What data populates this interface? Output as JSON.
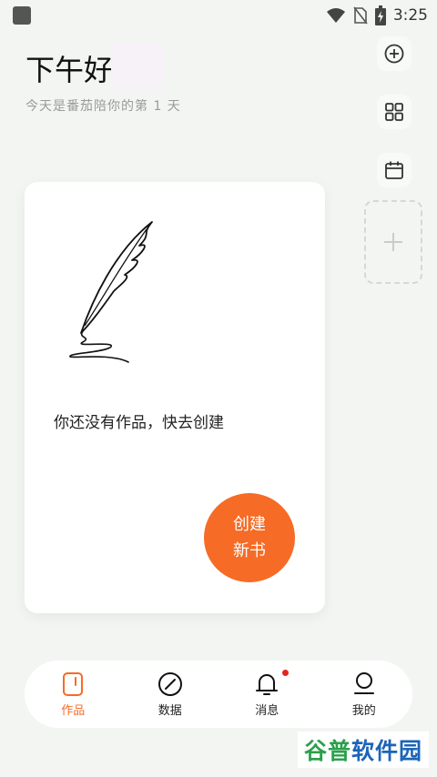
{
  "status_bar": {
    "time": "3:25"
  },
  "header": {
    "greeting": "下午好",
    "subtitle": "今天是番茄陪你的第 1 天"
  },
  "side_actions": [
    {
      "icon": "plus-circle-icon"
    },
    {
      "icon": "grid-icon"
    },
    {
      "icon": "calendar-icon"
    },
    {
      "icon": "plus-icon"
    }
  ],
  "main_card": {
    "empty_message": "你还没有作品，快去创建",
    "create_button_line1": "创建",
    "create_button_line2": "新书"
  },
  "bottom_nav": {
    "items": [
      {
        "label": "作品",
        "icon": "book-icon",
        "active": true
      },
      {
        "label": "数据",
        "icon": "compass-icon",
        "active": false
      },
      {
        "label": "消息",
        "icon": "bell-icon",
        "active": false,
        "badge": true
      },
      {
        "label": "我的",
        "icon": "profile-icon",
        "active": false
      }
    ]
  },
  "watermark": {
    "part1": "谷普",
    "part2": "软件园"
  },
  "colors": {
    "accent": "#f66b26",
    "badge": "#e3261f",
    "background": "#f3f5f3"
  }
}
